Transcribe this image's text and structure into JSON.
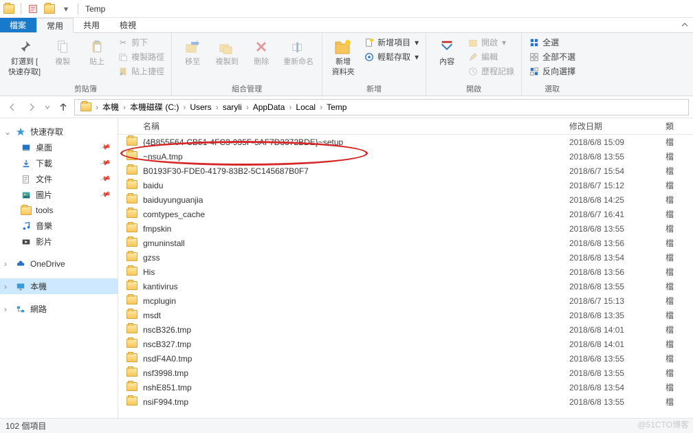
{
  "title": "Temp",
  "tabs": {
    "file": "檔案",
    "home": "常用",
    "share": "共用",
    "view": "檢視"
  },
  "ribbon": {
    "clipboard": {
      "pin": {
        "l1": "釘選到 [",
        "l2": "快速存取]"
      },
      "copy": "複製",
      "paste": "貼上",
      "cut": "剪下",
      "copy_path": "複製路徑",
      "paste_shortcut": "貼上捷徑",
      "label": "剪貼簿"
    },
    "organize": {
      "move_to": "移至",
      "copy_to": "複製到",
      "delete": "刪除",
      "rename": "重新命名",
      "label": "組合管理"
    },
    "new": {
      "new_folder_l1": "新增",
      "new_folder_l2": "資料夾",
      "new_item": "新增項目",
      "easy_access": "輕鬆存取",
      "label": "新增"
    },
    "open": {
      "properties": "內容",
      "open": "開啟",
      "edit": "編輯",
      "history": "歷程記錄",
      "label": "開啟"
    },
    "select": {
      "select_all": "全選",
      "select_none": "全部不選",
      "invert": "反向選擇",
      "label": "選取"
    }
  },
  "breadcrumb": [
    "本機",
    "本機磁碟 (C:)",
    "Users",
    "saryli",
    "AppData",
    "Local",
    "Temp"
  ],
  "sidebar": {
    "quick": {
      "header": "快速存取",
      "items": [
        "桌面",
        "下載",
        "文件",
        "圖片",
        "tools",
        "音樂",
        "影片"
      ]
    },
    "onedrive": "OneDrive",
    "thispc": "本機",
    "network": "網路"
  },
  "columns": {
    "name": "名稱",
    "date": "修改日期",
    "type": "類"
  },
  "files": [
    {
      "name": "{4B855F64-CB51-4FC3-935F-5AF7D3372BDE}~setup",
      "date": "2018/6/8 15:09",
      "type": "檔"
    },
    {
      "name": "~nsuA.tmp",
      "date": "2018/6/8 13:55",
      "type": "檔"
    },
    {
      "name": "B0193F30-FDE0-4179-83B2-5C145687B0F7",
      "date": "2018/6/7 15:54",
      "type": "檔"
    },
    {
      "name": "baidu",
      "date": "2018/6/7 15:12",
      "type": "檔"
    },
    {
      "name": "baiduyunguanjia",
      "date": "2018/6/8 14:25",
      "type": "檔"
    },
    {
      "name": "comtypes_cache",
      "date": "2018/6/7 16:41",
      "type": "檔"
    },
    {
      "name": "fmpskin",
      "date": "2018/6/8 13:55",
      "type": "檔"
    },
    {
      "name": "gmuninstall",
      "date": "2018/6/8 13:56",
      "type": "檔"
    },
    {
      "name": "gzss",
      "date": "2018/6/8 13:54",
      "type": "檔"
    },
    {
      "name": "His",
      "date": "2018/6/8 13:56",
      "type": "檔"
    },
    {
      "name": "kantivirus",
      "date": "2018/6/8 13:55",
      "type": "檔"
    },
    {
      "name": "mcplugin",
      "date": "2018/6/7 15:13",
      "type": "檔"
    },
    {
      "name": "msdt",
      "date": "2018/6/8 13:35",
      "type": "檔"
    },
    {
      "name": "nscB326.tmp",
      "date": "2018/6/8 14:01",
      "type": "檔"
    },
    {
      "name": "nscB327.tmp",
      "date": "2018/6/8 14:01",
      "type": "檔"
    },
    {
      "name": "nsdF4A0.tmp",
      "date": "2018/6/8 13:55",
      "type": "檔"
    },
    {
      "name": "nsf3998.tmp",
      "date": "2018/6/8 13:55",
      "type": "檔"
    },
    {
      "name": "nshE851.tmp",
      "date": "2018/6/8 13:54",
      "type": "檔"
    },
    {
      "name": "nsiF994.tmp",
      "date": "2018/6/8 13:55",
      "type": "檔"
    }
  ],
  "status": "102 個項目",
  "watermark": "@51CTO博客"
}
